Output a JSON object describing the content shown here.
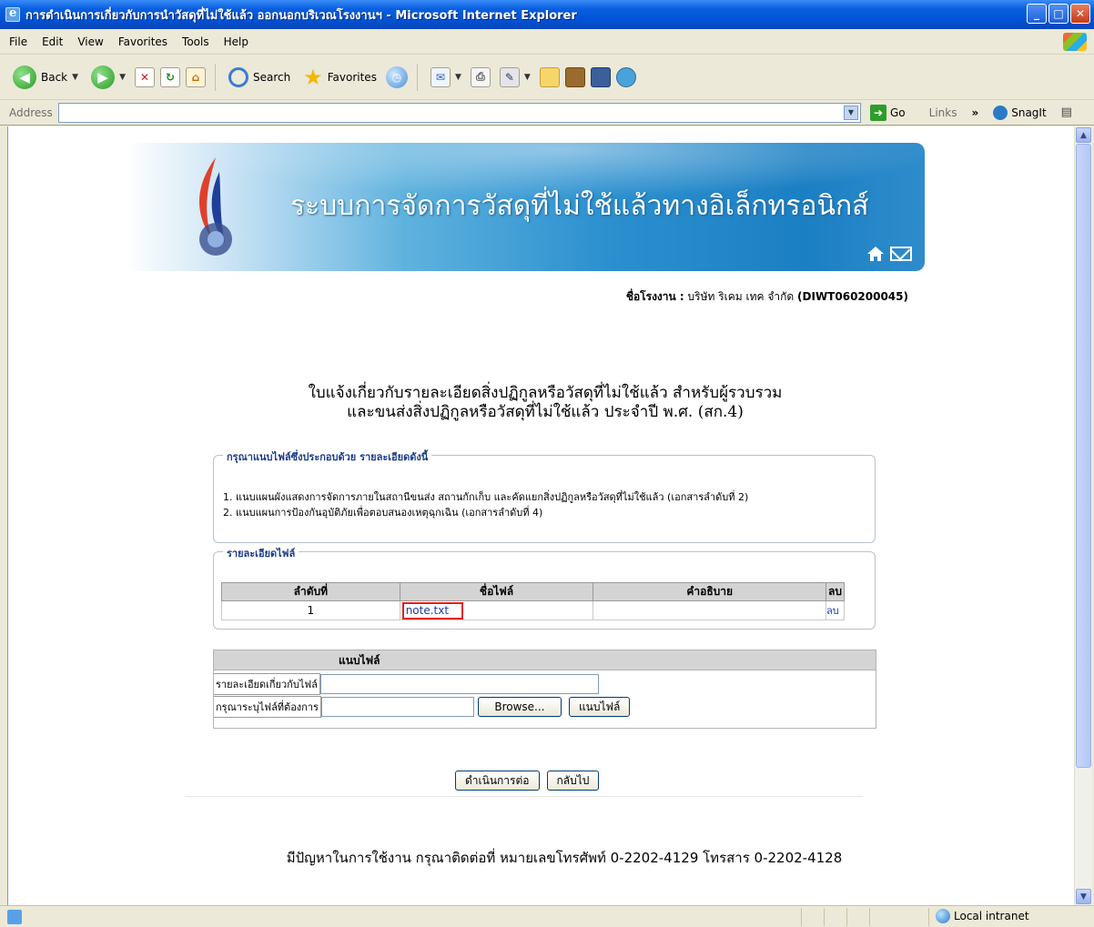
{
  "window": {
    "title": "การดำเนินการเกี่ยวกับการนำวัสดุที่ไม่ใช้แล้ว ออกนอกบริเวณโรงงานฯ - Microsoft Internet Explorer",
    "minimize": "_",
    "maximize": "□",
    "close": "✕"
  },
  "menu": [
    "File",
    "Edit",
    "View",
    "Favorites",
    "Tools",
    "Help"
  ],
  "toolbar": {
    "back_label": "Back",
    "search_label": "Search",
    "favorites_label": "Favorites"
  },
  "address": {
    "label": "Address",
    "value": "",
    "go_label": "Go",
    "links_label": "Links",
    "chevron": "»",
    "snagit_label": "SnagIt"
  },
  "page": {
    "banner_title": "ระบบการจัดการวัสดุที่ไม่ใช้แล้วทางอิเล็กทรอนิกส์",
    "factory_label": "ชื่อโรงงาน :",
    "factory_name": " บริษัท ริเคม เทค จำกัด ",
    "factory_code": "(DIWT060200045)",
    "heading_line1": "ใบแจ้งเกี่ยวกับรายละเอียดสิ่งปฏิกูลหรือวัสดุที่ไม่ใช้แล้ว สำหรับผู้รวบรวม",
    "heading_line2": "และขนส่งสิ่งปฏิกูลหรือวัสดุที่ไม่ใช้แล้ว ประจำปี พ.ศ. (สก.4)",
    "attach_req": {
      "legend": "กรุณาแนบไฟล์ซึ่งประกอบด้วย รายละเอียดดังนี้",
      "item1": "1. แนบแผนผังแสดงการจัดการภายในสถานีขนส่ง สถานกักเก็บ และคัดแยกสิ่งปฏิกูลหรือวัสดุที่ไม่ใช้แล้ว (เอกสารลำดับที่ 2)",
      "item2": "2. แนบแผนการป้องกันอุบัติภัยเพื่อตอบสนองเหตุฉุกเฉิน (เอกสารลำดับที่ 4)"
    },
    "file_details": {
      "legend": "รายละเอียดไฟล์",
      "columns": [
        "ลำดับที่",
        "ชื่อไฟล์",
        "คำอธิบาย",
        "ลบ"
      ],
      "rows": [
        {
          "index": "1",
          "file": "note.txt",
          "description": "",
          "delete": "ลบ"
        }
      ]
    },
    "attach_form": {
      "header": "แนบไฟล์",
      "desc_label": "รายละเอียดเกี่ยวกับไฟล์",
      "desc_value": "",
      "file_label": "กรุณาระบุไฟล์ที่ต้องการ",
      "file_value": "",
      "browse_label": "Browse...",
      "attach_button": "แนบไฟล์"
    },
    "continue_button": "ดำเนินการต่อ",
    "back_button": "กลับไป",
    "footer": "มีปัญหาในการใช้งาน กรุณาติดต่อที่ หมายเลขโทรศัพท์ 0-2202-4129 โทรสาร 0-2202-4128"
  },
  "status": {
    "zone": "Local intranet"
  }
}
